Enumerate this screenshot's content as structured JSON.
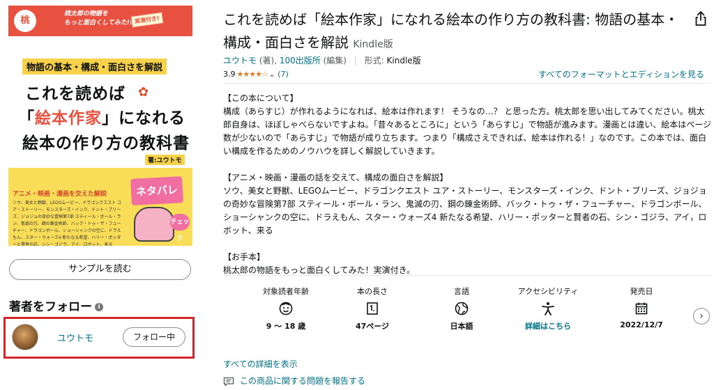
{
  "cover": {
    "banner_text_line1": "桃太郎の物語を",
    "banner_text_line2": "もっと面白くしてみた!!",
    "banner_badge": "実演付き!",
    "subtitle": "物語の基本・構成・面白さを解説",
    "title_line1": "これを読めば",
    "title_line2_pre": "「",
    "title_line2_red": "絵本作家",
    "title_line2_post": "」になれる",
    "title_line3": "絵本の作り方の教科書",
    "author": "著:ユウトモ",
    "bottom_title": "アニメ・映画・漫画を交えた解説",
    "bottom_text": "ソウ、美女と野獣、LEGOムービー、ドラゴンクエスト ユア・ストーリー、モンスターズ・インク、ドント・ブリーズ、ジョジョの奇妙な冒険第7部 スティール・ボール・ラン、鬼滅の刃、鋼の錬金術師、バック・トゥ・ザ・フューチャー、ドラゴンボール、ショーシャンクの空に、ドラえもん、スター・ウォーズ4 新たなる希望、ハリー・ポッターと賢者の石、シン・ゴジラ、アイ、ロボット、来る",
    "neta_label": "ネタバレ",
    "check_label": "チェック"
  },
  "left": {
    "sample_button": "サンプルを読む",
    "follow_heading": "著者をフォロー",
    "author_name": "ユウトモ",
    "follow_button": "フォロー中"
  },
  "product": {
    "title": "これを読めば「絵本作家」になれる絵本の作り方の教科書: 物語の基本・構成・面白さを解説",
    "format": "Kindle版",
    "author_link": "ユウトモ",
    "author_role": "(著),",
    "publisher_link": "100出版所",
    "publisher_role": "(編集)",
    "format_label": "形式:",
    "format_value": "Kindle版",
    "rating_value": "3.9",
    "rating_stars": "★★★★☆",
    "rating_count": "(7)",
    "all_formats_link": "すべてのフォーマットとエディションを見る"
  },
  "description": {
    "heading1": "【この本について】",
    "para1": "構成（あらすじ）が作れるようになれば、絵本は作れます！ そうなの…？ と思った方。桃太郎を思い出してみてください。桃太郎自身は、ほぼしゃべらないですよね。「昔々あるところに」という「あらすじ」で物語が進みます。漫画とは違い、絵本はページ数が少ないので「あらすじ」で物語が成り立ちます。つまり「構成さえできれば、絵本は作れる！」なのです。この本では、面白い構成を作るためのノウハウを詳しく解説していきます。",
    "heading2": "【アニメ・映画・漫画の話を交えて、構成の面白さを解説】",
    "para2": "ソウ、美女と野獣、LEGOムービー、ドラゴンクエスト ユア・ストーリー、モンスターズ・インク、ドント・ブリーズ、ジョジョの奇妙な冒険第7部 スティール・ボール・ラン、鬼滅の刃、鋼の錬金術師、バック・トゥ・ザ・フューチャー、ドラゴンボール、ショーシャンクの空に、ドラえもん、スター・ウォーズ4 新たなる希望、ハリー・ポッターと賢者の石、シン・ゴジラ、アイ，ロボット、来る",
    "heading3": "【お手本】",
    "para3": "桃太郎の物語をもっと面白くしてみた！実演付き。"
  },
  "attributes": [
    {
      "label": "対象読者年齢",
      "icon": "face-icon",
      "value": "9 ～ 18 歳"
    },
    {
      "label": "本の長さ",
      "icon": "page-icon",
      "value": "47ページ"
    },
    {
      "label": "言語",
      "icon": "globe-icon",
      "value": "日本語"
    },
    {
      "label": "アクセシビリティ",
      "icon": "accessibility-icon",
      "value": "詳細はこちら"
    },
    {
      "label": "発売日",
      "icon": "calendar-icon",
      "value": "2022/12/7"
    }
  ],
  "links": {
    "all_details": "すべての詳細を表示",
    "report_issue": "この商品に関する問題を報告する"
  },
  "colors": {
    "link": "#007185",
    "star": "#de7921",
    "highlight_border": "#d3252a",
    "cover_banner": "#e8503f",
    "cover_yellow": "#f9dc57"
  }
}
